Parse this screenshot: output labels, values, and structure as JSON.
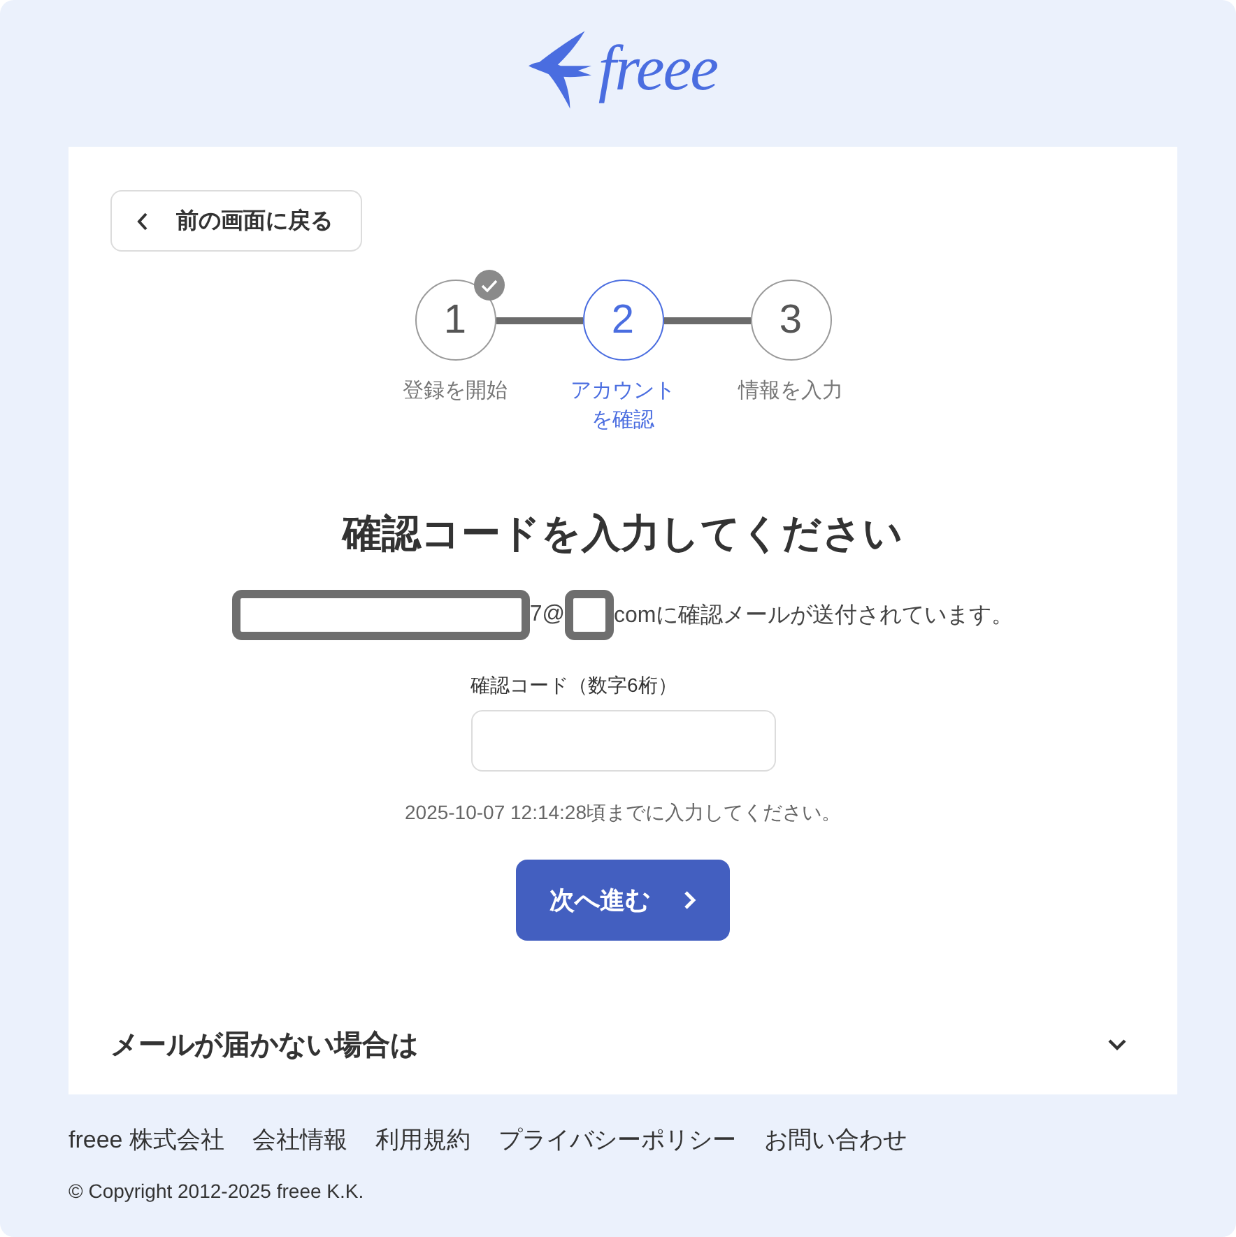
{
  "logo": {
    "text": "freee"
  },
  "back_button": {
    "label": "前の画面に戻る"
  },
  "steps": [
    {
      "number": "1",
      "label": "登録を開始",
      "done": true,
      "selected": false
    },
    {
      "number": "2",
      "label": "アカウントを確認",
      "done": false,
      "selected": true
    },
    {
      "number": "3",
      "label": "情報を入力",
      "done": false,
      "selected": false
    }
  ],
  "heading": "確認コードを入力してください",
  "notice": [
    {
      "kind": "wide_redaction"
    },
    {
      "kind": "text",
      "text": "7@"
    },
    {
      "kind": "narrow_redaction"
    },
    {
      "kind": "text",
      "text": "comに確認メールが送付されています。"
    }
  ],
  "code_field": {
    "label": "確認コード（数字6桁）"
  },
  "deadline": "2025-10-07 12:14:28頃までに入力してください。",
  "next_button": {
    "label": "次へ進む"
  },
  "help_section": {
    "title": "メールが届かない場合は",
    "expanded": false
  },
  "footer": {
    "links": [
      "freee 株式会社",
      "会社情報",
      "利用規約",
      "プライバシーポリシー",
      "お問い合わせ"
    ],
    "copyright": "© Copyright 2012-2025 freee K.K."
  }
}
